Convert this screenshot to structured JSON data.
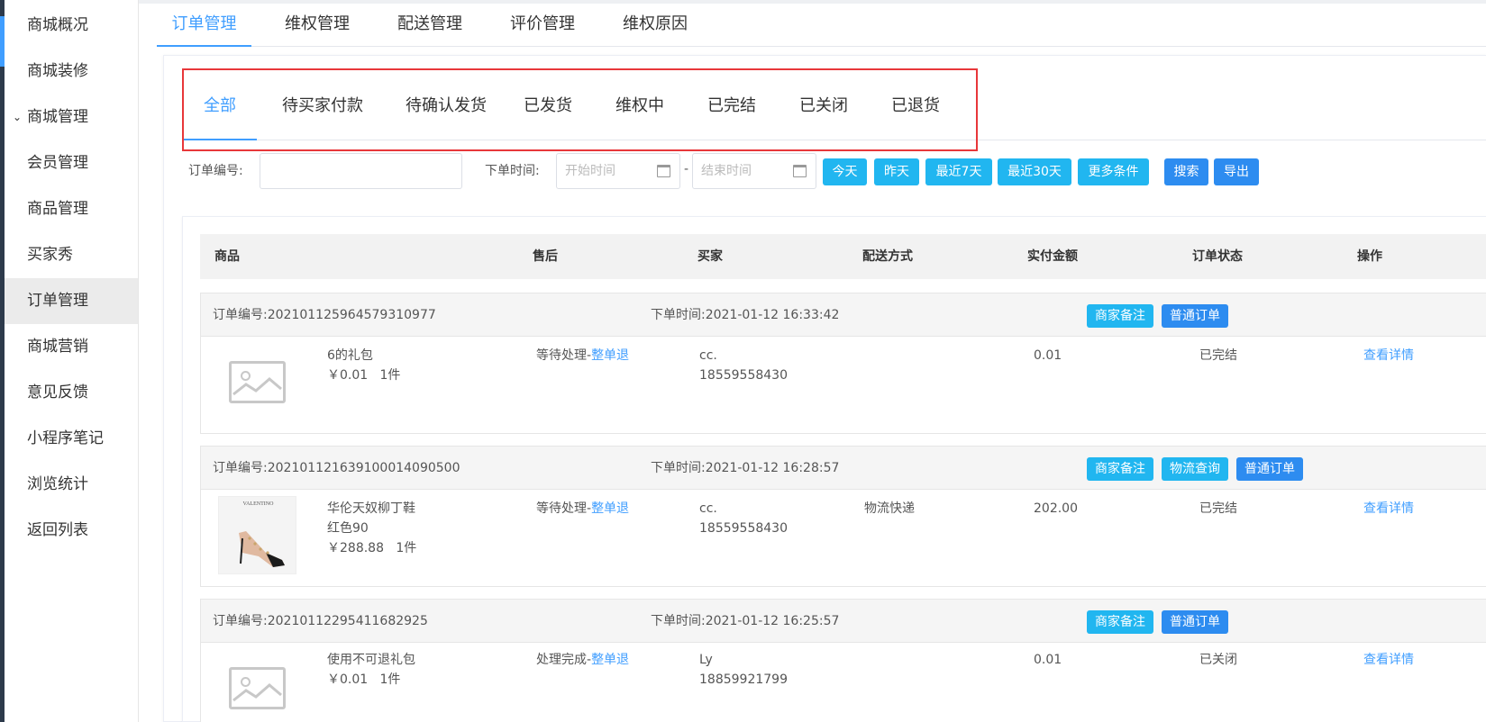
{
  "sidebar": {
    "items": [
      {
        "label": "商城概况"
      },
      {
        "label": "商城装修"
      },
      {
        "label": "商城管理"
      },
      {
        "label": "会员管理"
      },
      {
        "label": "商品管理"
      },
      {
        "label": "买家秀"
      },
      {
        "label": "订单管理"
      },
      {
        "label": "商城营销"
      },
      {
        "label": "意见反馈"
      },
      {
        "label": "小程序笔记"
      },
      {
        "label": "浏览统计"
      },
      {
        "label": "返回列表"
      }
    ],
    "active_index": 6
  },
  "top_tabs": [
    {
      "label": "订单管理"
    },
    {
      "label": "维权管理"
    },
    {
      "label": "配送管理"
    },
    {
      "label": "评价管理"
    },
    {
      "label": "维权原因"
    }
  ],
  "status_tabs": [
    {
      "label": "全部"
    },
    {
      "label": "待买家付款"
    },
    {
      "label": "待确认发货"
    },
    {
      "label": "已发货"
    },
    {
      "label": "维权中"
    },
    {
      "label": "已完结"
    },
    {
      "label": "已关闭"
    },
    {
      "label": "已退货"
    }
  ],
  "filters": {
    "order_no_label": "订单编号:",
    "order_time_label": "下单时间:",
    "start_placeholder": "开始时间",
    "end_placeholder": "结束时间",
    "separator": "-",
    "buttons": {
      "today": "今天",
      "yesterday": "昨天",
      "last7": "最近7天",
      "last30": "最近30天",
      "more": "更多条件",
      "search": "搜索",
      "export": "导出"
    }
  },
  "table": {
    "headers": {
      "product": "商品",
      "aftersale": "售后",
      "buyer": "买家",
      "delivery": "配送方式",
      "amount": "实付金额",
      "status": "订单状态",
      "action": "操作"
    }
  },
  "orders": [
    {
      "order_no": "订单编号:20210112596457931097​7",
      "order_time": "下单时间:2021-01-12 16:33:42",
      "buttons": [
        "商家备注",
        "普通订单"
      ],
      "product_name": "6的礼包",
      "price_qty": "￥0.01   1件",
      "aftersale_status": "等待处理-",
      "aftersale_link": "整单退",
      "buyer_name": "cc.",
      "buyer_phone": "18559558430",
      "delivery": "",
      "amount": "0.01",
      "status": "已完结",
      "action": "查看详情"
    },
    {
      "order_no": "订单编号:20210112163910001409050​0",
      "order_time": "下单时间:2021-01-12 16:28:57",
      "buttons": [
        "商家备注",
        "物流查询",
        "普通订单"
      ],
      "product_name": "华伦天奴柳丁鞋",
      "product_spec": "红色90",
      "price_qty": "￥288.88   1件",
      "aftersale_status": "等待处理-",
      "aftersale_link": "整单退",
      "buyer_name": "cc.",
      "buyer_phone": "18559558430",
      "delivery": "物流快递",
      "amount": "202.00",
      "status": "已完结",
      "action": "查看详情",
      "photo_brand": "VALENTINO"
    },
    {
      "order_no": "订单编号:20210112295411682925",
      "order_time": "下单时间:2021-01-12 16:25:57",
      "buttons": [
        "商家备注",
        "普通订单"
      ],
      "product_name": "使用不可退礼包",
      "price_qty": "￥0.01   1件",
      "aftersale_status": "处理完成-",
      "aftersale_link": "整单退",
      "buyer_name": "Ly",
      "buyer_phone": "18859921799",
      "delivery": "",
      "amount": "0.01",
      "status": "已关闭",
      "action": "查看详情"
    }
  ]
}
